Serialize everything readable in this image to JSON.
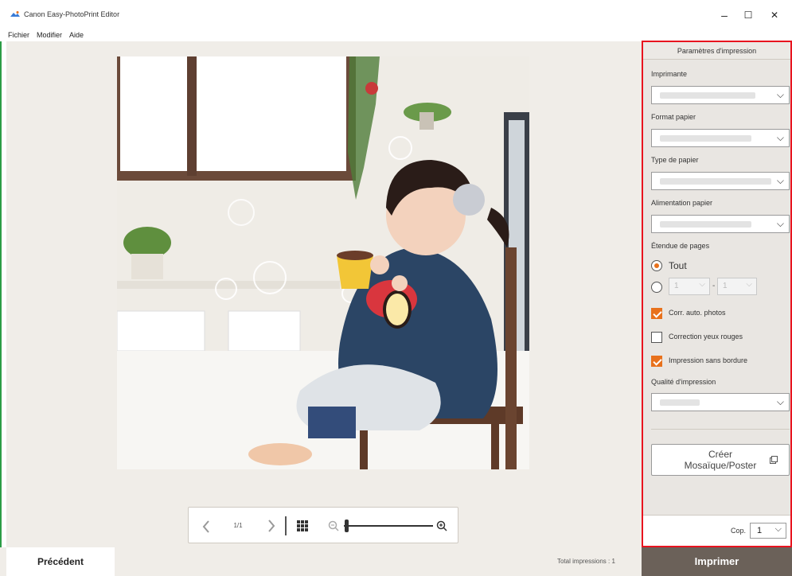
{
  "window": {
    "title": "Canon Easy-PhotoPrint Editor",
    "minimize": "–",
    "maximize": "☐",
    "close": "✕"
  },
  "menu": [
    "Fichier",
    "Modifier",
    "Aide"
  ],
  "viewer": {
    "page_indicator": "1/1"
  },
  "panel": {
    "header": "Paramètres d'impression",
    "printer_label": "Imprimante",
    "paper_size_label": "Format papier",
    "paper_type_label": "Type de papier",
    "paper_source_label": "Alimentation papier",
    "page_range_label": "Étendue de pages",
    "all_option": "Tout",
    "range_from": "1",
    "range_to": "1",
    "range_sep": "-",
    "auto_correct": "Corr. auto. photos",
    "red_eye": "Correction yeux rouges",
    "borderless": "Impression sans bordure",
    "quality_label": "Qualité d'impression",
    "mosaic_line1": "Créer",
    "mosaic_line2": "Mosaïque/Poster",
    "copies_label": "Cop.",
    "copies_value": "1"
  },
  "bottom": {
    "previous": "Précédent",
    "total": "Total impressions : 1",
    "print": "Imprimer"
  },
  "colors": {
    "accent": "#e8711c",
    "panel_border": "#e8141f",
    "print_button": "#6b6159"
  }
}
